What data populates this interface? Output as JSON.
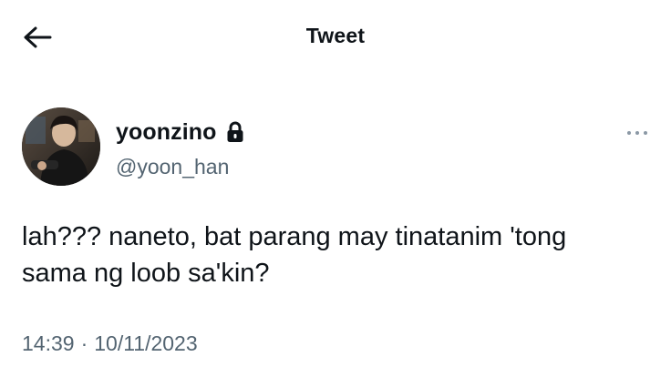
{
  "header": {
    "back_icon": "arrow-left-icon",
    "title": "Tweet"
  },
  "author": {
    "display_name": "yoonzino",
    "handle": "@yoon_han",
    "lock_icon": "lock-icon",
    "more_icon": "more-horizontal-icon"
  },
  "tweet": {
    "text": "lah??? naneto, bat parang may tinatanim 'tong\nsama ng loob sa'kin?",
    "time": "14:39",
    "separator": "·",
    "date": "10/11/2023"
  },
  "colors": {
    "text_primary": "#0f1419",
    "text_secondary": "#536471",
    "background": "#ffffff"
  }
}
